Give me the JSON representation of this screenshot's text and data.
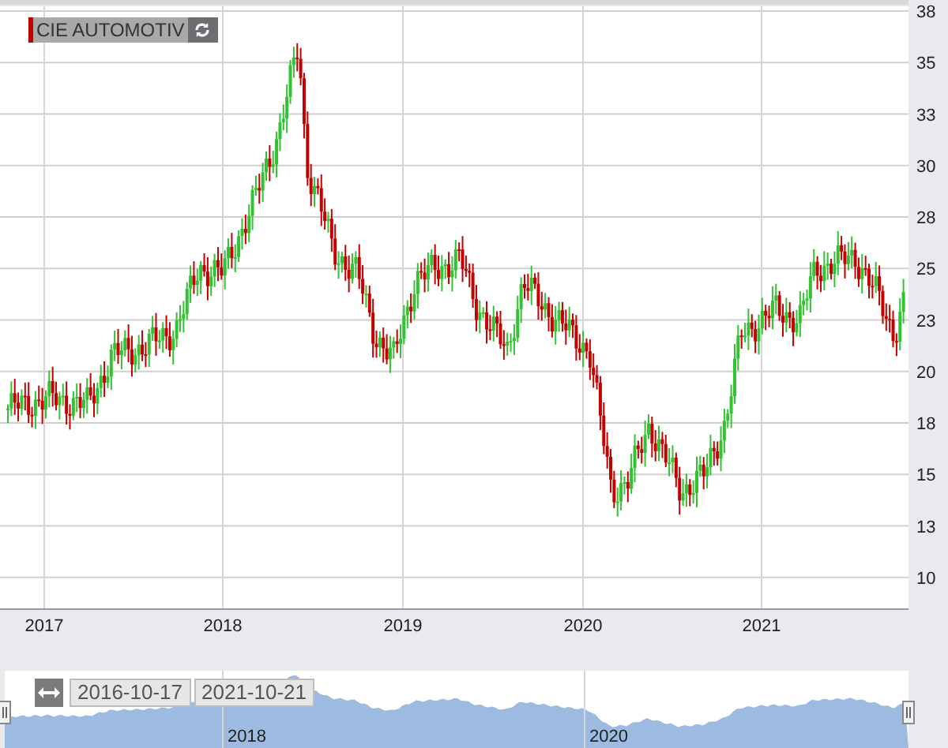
{
  "series_label": {
    "text": "CIE AUTOMOTIV",
    "color": "#c00000"
  },
  "y_axis": {
    "ticks": [
      "38",
      "35",
      "33",
      "30",
      "28",
      "25",
      "23",
      "20",
      "18",
      "15",
      "13",
      "10"
    ]
  },
  "x_axis": {
    "ticks": [
      "2017",
      "2018",
      "2019",
      "2020",
      "2021"
    ]
  },
  "navigator": {
    "from": "2016-10-17",
    "to": "2021-10-21",
    "years": [
      "2018",
      "2020"
    ]
  }
}
